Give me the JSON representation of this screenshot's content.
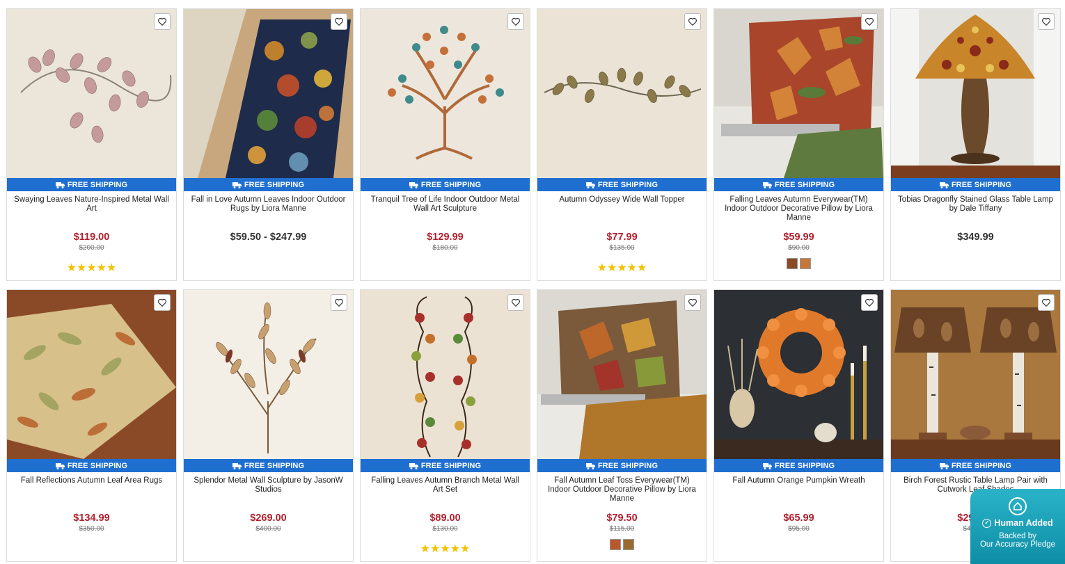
{
  "shipping_label": "FREE SHIPPING",
  "colors": {
    "shipping_bar": "#1f6fd1",
    "sale_price": "#b2202e",
    "stars": "#f2c200",
    "badge": "#1aa0b8"
  },
  "icons": {
    "wishlist": "heart-icon",
    "truck": "truck-icon"
  },
  "products": [
    {
      "title": "Swaying Leaves Nature-Inspired Metal Wall Art",
      "price": "$119.00",
      "was": "$200.00",
      "rating": 5,
      "image": "metal-leaves-wall-art"
    },
    {
      "title": "Fall in Love Autumn Leaves Indoor Outdoor Rugs by Liora Manne",
      "price": "$59.50 - $247.99",
      "was": "",
      "rating": 0,
      "image": "autumn-leaves-runner-rug"
    },
    {
      "title": "Tranquil Tree of Life Indoor Outdoor Metal Wall Art Sculpture",
      "price": "$129.99",
      "was": "$180.00",
      "rating": 0,
      "image": "tree-of-life-sculpture"
    },
    {
      "title": "Autumn Odyssey Wide Wall Topper",
      "price": "$77.99",
      "was": "$135.00",
      "rating": 5,
      "image": "wide-wall-topper"
    },
    {
      "title": "Falling Leaves Autumn Everywear(TM) Indoor Outdoor Decorative Pillow by Liora Manne",
      "price": "$59.99",
      "was": "$90.00",
      "rating": 0,
      "image": "falling-leaves-pillow",
      "swatches": [
        "#8a4a22",
        "#c4773a"
      ]
    },
    {
      "title": "Tobias Dragonfly Stained Glass Table Lamp by Dale Tiffany",
      "price": "$349.99",
      "was": "",
      "rating": 0,
      "image": "dragonfly-tiffany-lamp"
    },
    {
      "title": "Fall Reflections Autumn Leaf Area Rugs",
      "price": "$134.99",
      "was": "$350.00",
      "rating": 0,
      "image": "autumn-leaf-area-rug"
    },
    {
      "title": "Splendor Metal Wall Sculpture by JasonW Studios",
      "price": "$269.00",
      "was": "$400.00",
      "rating": 0,
      "image": "metal-branch-sculpture"
    },
    {
      "title": "Falling Leaves Autumn Branch Metal Wall Art Set",
      "price": "$89.00",
      "was": "$130.00",
      "rating": 5,
      "image": "branch-metal-wall-art-set"
    },
    {
      "title": "Fall Autumn Leaf Toss Everywear(TM) Indoor Outdoor Decorative Pillow by Liora Manne",
      "price": "$79.50",
      "was": "$115.00",
      "rating": 0,
      "image": "leaf-toss-pillow",
      "swatches": [
        "#b8572a",
        "#9a6a2e"
      ]
    },
    {
      "title": "Fall Autumn Orange Pumpkin Wreath",
      "price": "$65.99",
      "was": "$95.00",
      "rating": 0,
      "image": "pumpkin-wreath"
    },
    {
      "title": "Birch Forest Rustic Table Lamp Pair with Cutwork Leaf Shades",
      "price": "$295.99",
      "was": "$425.00",
      "rating": 0,
      "image": "birch-lamp-pair"
    }
  ],
  "badge": {
    "title": "Human Added",
    "line1": "Backed by",
    "line2": "Our Accuracy Pledge",
    "icon": "house-icon"
  }
}
